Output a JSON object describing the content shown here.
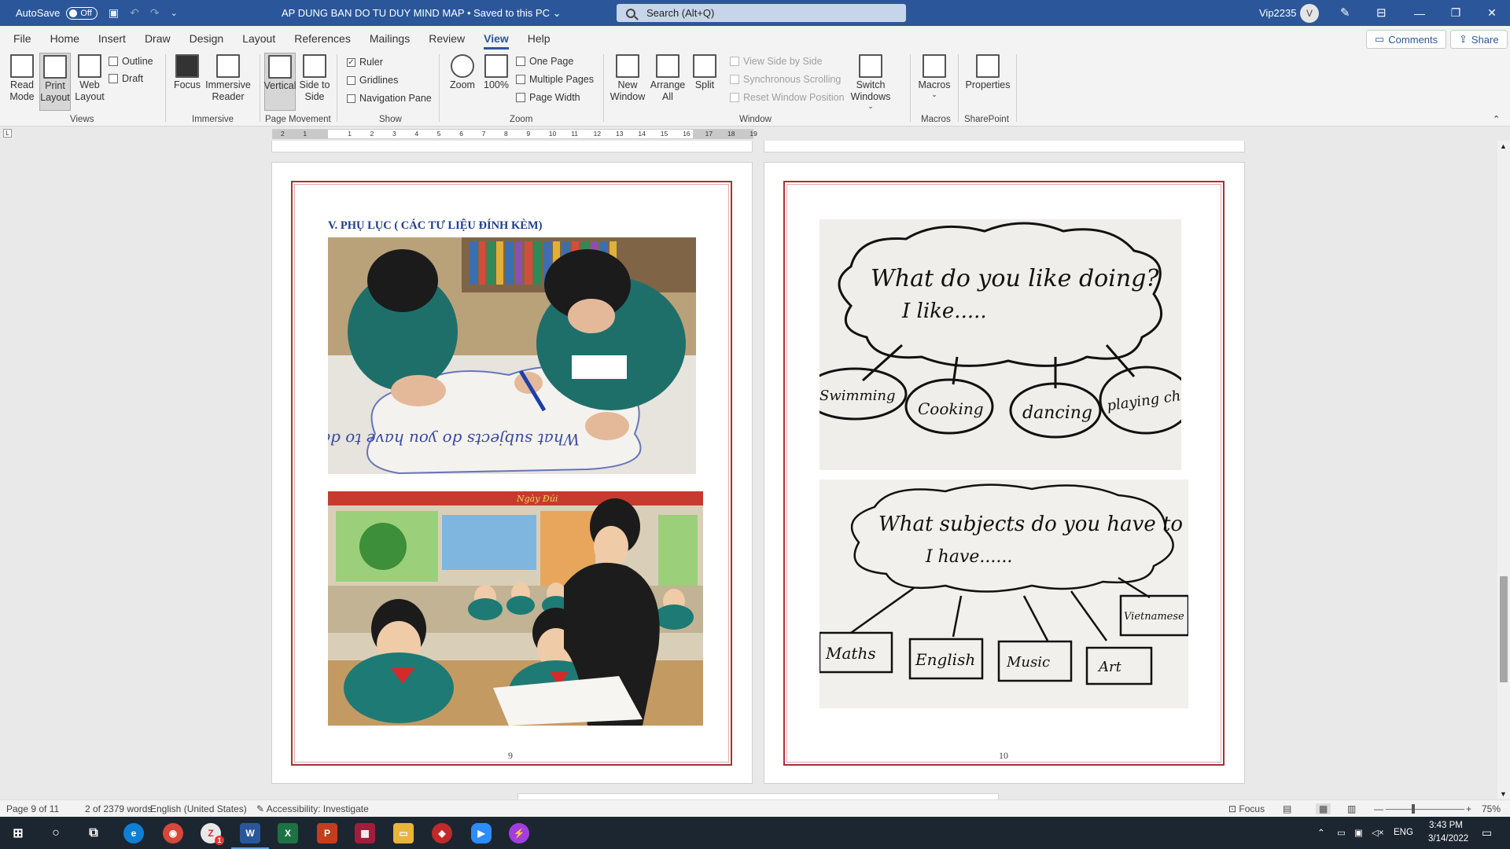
{
  "titlebar": {
    "autosave_label": "AutoSave",
    "autosave_state": "Off",
    "document_title": "AP DUNG BAN DO TU DUY MIND MAP • Saved to this PC",
    "search_placeholder": "Search (Alt+Q)",
    "user_name": "Vip2235",
    "avatar_initial": "V"
  },
  "menu": {
    "items": [
      "File",
      "Home",
      "Insert",
      "Draw",
      "Design",
      "Layout",
      "References",
      "Mailings",
      "Review",
      "View",
      "Help"
    ],
    "active": "View",
    "comments_label": "Comments",
    "share_label": "Share"
  },
  "ribbon": {
    "views": {
      "read_mode": "Read Mode",
      "print_layout": "Print Layout",
      "web_layout": "Web Layout",
      "outline": "Outline",
      "draft": "Draft",
      "group_label": "Views"
    },
    "immersive": {
      "focus": "Focus",
      "immersive_reader": "Immersive Reader",
      "group_label": "Immersive"
    },
    "page_movement": {
      "vertical": "Vertical",
      "side_to_side": "Side to Side",
      "group_label": "Page Movement"
    },
    "show": {
      "ruler": "Ruler",
      "gridlines": "Gridlines",
      "navigation_pane": "Navigation Pane",
      "group_label": "Show"
    },
    "zoom": {
      "zoom": "Zoom",
      "hundred": "100%",
      "one_page": "One Page",
      "multiple_pages": "Multiple Pages",
      "page_width": "Page Width",
      "group_label": "Zoom"
    },
    "window": {
      "new_window": "New Window",
      "arrange_all": "Arrange All",
      "split": "Split",
      "view_side_by_side": "View Side by Side",
      "sync_scrolling": "Synchronous Scrolling",
      "reset_window": "Reset Window Position",
      "switch_windows": "Switch Windows",
      "group_label": "Window"
    },
    "macros": {
      "macros": "Macros",
      "group_label": "Macros"
    },
    "sharepoint": {
      "properties": "Properties",
      "group_label": "SharePoint"
    }
  },
  "ruler": {
    "ticks": [
      "2",
      "1",
      "",
      "1",
      "2",
      "3",
      "4",
      "5",
      "6",
      "7",
      "8",
      "9",
      "10",
      "11",
      "12",
      "13",
      "14",
      "15",
      "16",
      "17",
      "18",
      "19"
    ]
  },
  "document": {
    "page9": {
      "heading": "V. PHỤ LỤC ( CÁC TƯ LIỆU ĐÍNH KÈM)",
      "page_number": "9",
      "photo1_writing": "What subjects do you have to day ?",
      "photo2_banner": "Ngày Đúi"
    },
    "page10": {
      "page_number": "10",
      "mindmap1": {
        "question": "What do you like doing?",
        "answer": "I like.....",
        "branches": [
          "Swimming",
          "Cooking",
          "dancing",
          "playing chess"
        ]
      },
      "mindmap2": {
        "question": "What subjects do you have to day",
        "answer": "I have......",
        "branches": [
          "Maths",
          "English",
          "Music",
          "Art",
          "Vietnamese"
        ]
      }
    }
  },
  "statusbar": {
    "page": "Page 9 of 11",
    "words": "2 of 2379 words",
    "language": "English (United States)",
    "accessibility": "Accessibility: Investigate",
    "focus": "Focus",
    "zoom": "75%"
  },
  "taskbar": {
    "lang": "ENG",
    "time": "3:43 PM",
    "date": "3/14/2022",
    "badge": "1"
  },
  "colors": {
    "word_blue": "#2b579a",
    "frame_red": "#a3333a",
    "heading_blue": "#1f3d8a"
  }
}
